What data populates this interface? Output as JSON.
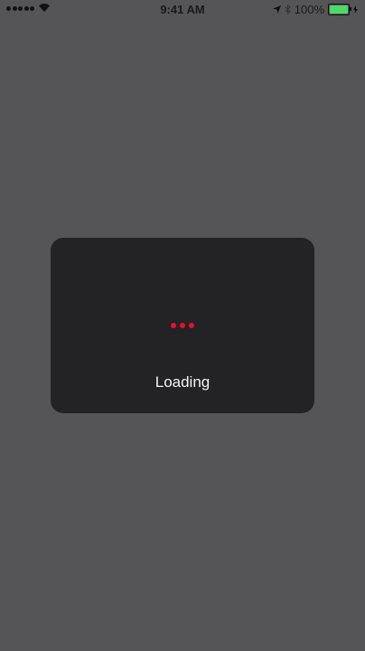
{
  "status_bar": {
    "time": "9:41 AM",
    "battery_percent": "100%",
    "battery_level": 1.0,
    "signal_bars": 5,
    "battery_color": "#4cd964"
  },
  "loading": {
    "label": "Loading",
    "dot_color": "#e8102c"
  }
}
